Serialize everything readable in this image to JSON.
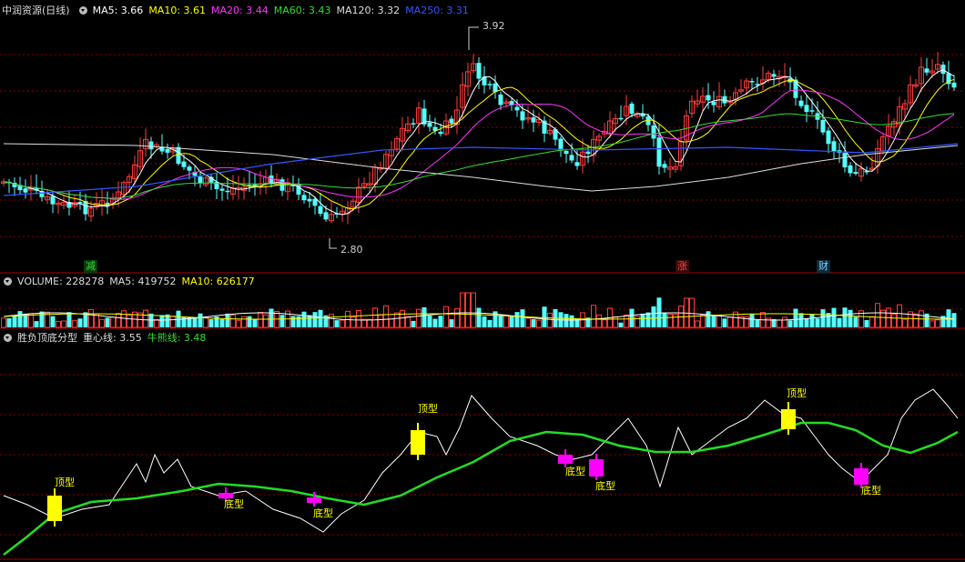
{
  "main": {
    "title": "中润资源(日线)",
    "ma": [
      {
        "label": "MA5: 3.66",
        "color": "#ffffff"
      },
      {
        "label": "MA10: 3.61",
        "color": "#ffff00"
      },
      {
        "label": "MA20: 3.44",
        "color": "#ff33ff"
      },
      {
        "label": "MA60: 3.43",
        "color": "#33dd33"
      },
      {
        "label": "MA120: 3.32",
        "color": "#dddddd"
      },
      {
        "label": "MA250: 3.31",
        "color": "#3355ff"
      }
    ],
    "high_label": "3.92",
    "low_label": "2.80",
    "markers": [
      {
        "label": "减",
        "color": "#33dd33"
      },
      {
        "label": "涨",
        "color": "#ff4444"
      },
      {
        "label": "财",
        "color": "#88ccff"
      }
    ]
  },
  "volume": {
    "title": "VOLUME: 228278",
    "ma5": "MA5: 419752",
    "ma10": "MA10: 626177"
  },
  "indicator": {
    "title": "胜负顶底分型",
    "line1": "重心线: 3.55",
    "line2": "牛熊线: 3.48",
    "signals": [
      "顶型",
      "底型",
      "底型",
      "顶型",
      "底型",
      "底型",
      "顶型",
      "底型"
    ]
  },
  "colors": {
    "up": "#ff3b3b",
    "down": "#54ffff",
    "grid": "#8b0000",
    "top_signal": "#ffff00",
    "bottom_signal": "#ff00ff"
  }
}
